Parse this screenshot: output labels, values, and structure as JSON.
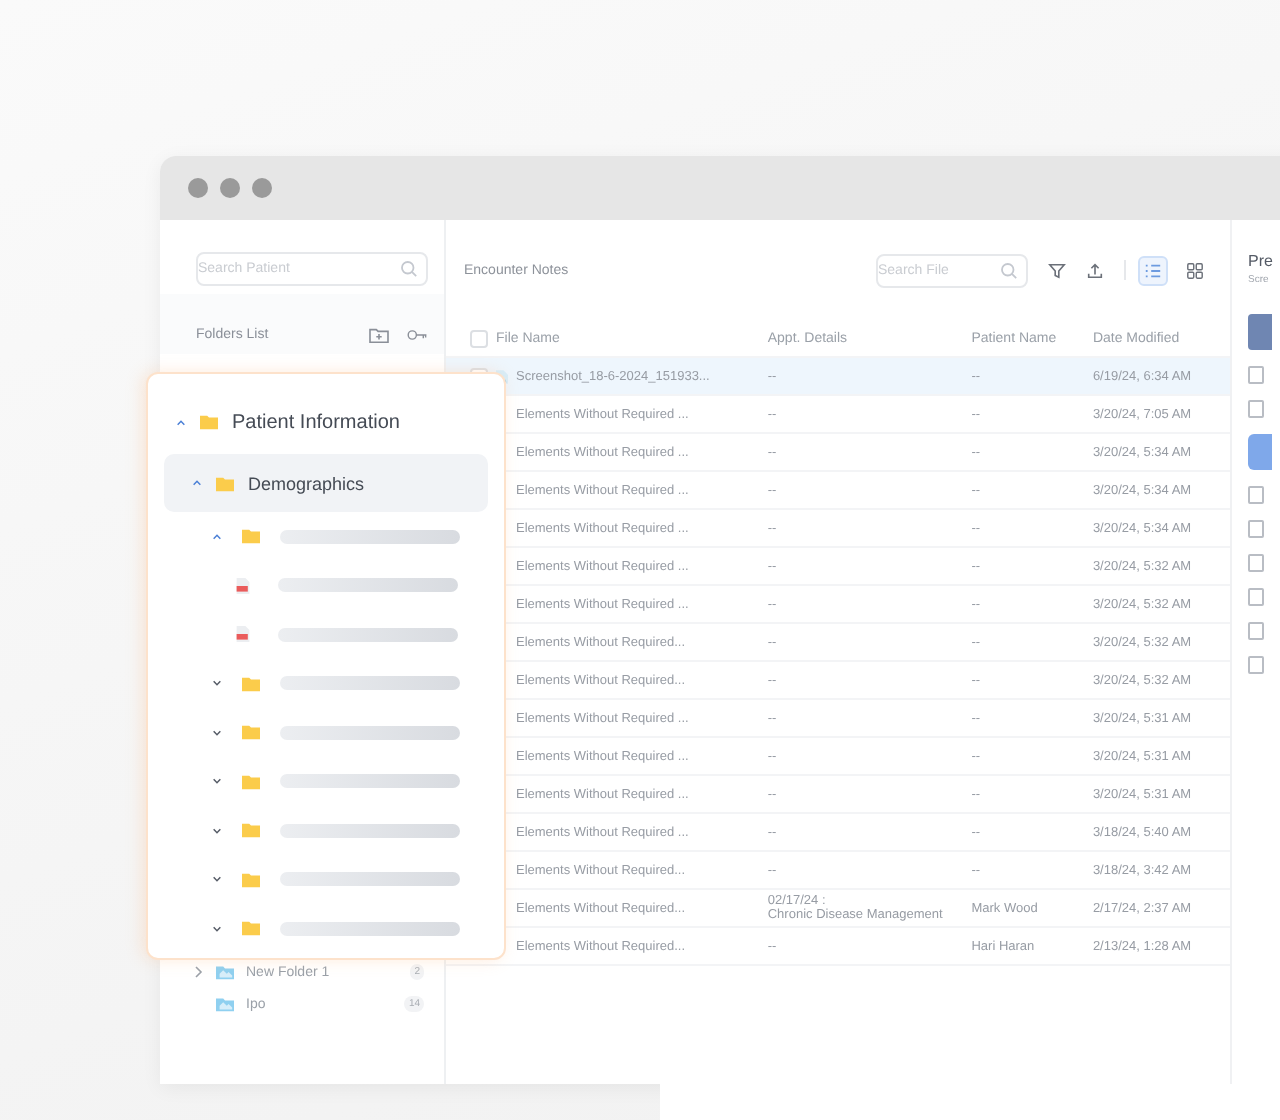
{
  "sidebar": {
    "search": {
      "placeholder": "Search Patient"
    },
    "folders_title": "Folders List",
    "items": [
      {
        "label": "New Folder 1",
        "count": "2",
        "kind": "parent",
        "expanded": false
      },
      {
        "label": "Ipo",
        "count": "14",
        "kind": "leaf"
      }
    ]
  },
  "main": {
    "title": "Encounter Notes",
    "search": {
      "placeholder": "Search File"
    },
    "views": [
      {
        "kind": "list",
        "selected": true
      },
      {
        "kind": "grid",
        "selected": false
      }
    ],
    "table": {
      "all_checked": false,
      "columns": [
        "File Name",
        "Appt. Details",
        "Patient Name",
        "Date Modified"
      ],
      "rows": [
        {
          "file": "Screenshot_18-6-2024_151933...",
          "appt": "--",
          "patient": "--",
          "date": "6/19/24, 6:34 AM",
          "selected": true,
          "checked": false
        },
        {
          "file": "Elements Without Required ...",
          "appt": "--",
          "patient": "--",
          "date": "3/20/24, 7:05 AM",
          "selected": false
        },
        {
          "file": "Elements Without Required ...",
          "appt": "--",
          "patient": "--",
          "date": "3/20/24, 5:34 AM",
          "selected": false
        },
        {
          "file": "Elements Without Required ...",
          "appt": "--",
          "patient": "--",
          "date": "3/20/24, 5:34 AM",
          "selected": false
        },
        {
          "file": "Elements Without Required ...",
          "appt": "--",
          "patient": "--",
          "date": "3/20/24, 5:34 AM",
          "selected": false
        },
        {
          "file": "Elements Without Required ...",
          "appt": "--",
          "patient": "--",
          "date": "3/20/24, 5:32 AM",
          "selected": false
        },
        {
          "file": "Elements Without Required ...",
          "appt": "--",
          "patient": "--",
          "date": "3/20/24, 5:32 AM",
          "selected": false
        },
        {
          "file": "Elements Without Required...",
          "appt": "--",
          "patient": "--",
          "date": "3/20/24, 5:32 AM",
          "selected": false
        },
        {
          "file": "Elements Without Required...",
          "appt": "--",
          "patient": "--",
          "date": "3/20/24, 5:32 AM",
          "selected": false
        },
        {
          "file": "Elements Without Required ...",
          "appt": "--",
          "patient": "--",
          "date": "3/20/24, 5:31 AM",
          "selected": false
        },
        {
          "file": "Elements Without Required ...",
          "appt": "--",
          "patient": "--",
          "date": "3/20/24, 5:31 AM",
          "selected": false
        },
        {
          "file": "Elements Without Required ...",
          "appt": "--",
          "patient": "--",
          "date": "3/20/24, 5:31 AM",
          "selected": false
        },
        {
          "file": "Elements Without Required ...",
          "appt": "--",
          "patient": "--",
          "date": "3/18/24, 5:40 AM",
          "selected": false
        },
        {
          "file": "Elements Without Required...",
          "appt": "--",
          "patient": "--",
          "date": "3/18/24, 3:42 AM",
          "selected": false
        },
        {
          "file": "Elements Without Required...",
          "appt": "02/17/24 :\nChronic Disease Management",
          "patient": "Mark Wood",
          "date": "2/17/24, 2:37 AM",
          "selected": false
        },
        {
          "file": "Elements Without Required...",
          "appt": "--",
          "patient": "Hari Haran",
          "date": "2/13/24, 1:28 AM",
          "selected": false
        }
      ]
    }
  },
  "preview": {
    "title": "Pre",
    "subtitle": "Scre",
    "tools": [
      {
        "kind": "thumbnail",
        "selected": false
      },
      {
        "kind": "tool",
        "selected": false
      },
      {
        "kind": "tool",
        "selected": false
      },
      {
        "kind": "tool",
        "selected": true
      },
      {
        "kind": "tool",
        "selected": false
      },
      {
        "kind": "tool",
        "selected": false
      },
      {
        "kind": "tool",
        "selected": false
      },
      {
        "kind": "tool",
        "selected": false
      },
      {
        "kind": "tool",
        "selected": false
      },
      {
        "kind": "tool",
        "selected": false
      }
    ]
  },
  "popup_tree": [
    {
      "label": "Patient Information",
      "expanded": true,
      "selected": false,
      "children": [
        {
          "label": "Demographics",
          "expanded": true,
          "selected": true,
          "children": [
            {
              "kind": "folder",
              "expanded": true,
              "children": [
                {
                  "kind": "file"
                },
                {
                  "kind": "file"
                }
              ]
            },
            {
              "kind": "folder",
              "expanded": false
            },
            {
              "kind": "folder",
              "expanded": false
            },
            {
              "kind": "folder",
              "expanded": false
            },
            {
              "kind": "folder",
              "expanded": false
            },
            {
              "kind": "folder",
              "expanded": false
            },
            {
              "kind": "folder",
              "expanded": false
            }
          ]
        }
      ]
    }
  ]
}
